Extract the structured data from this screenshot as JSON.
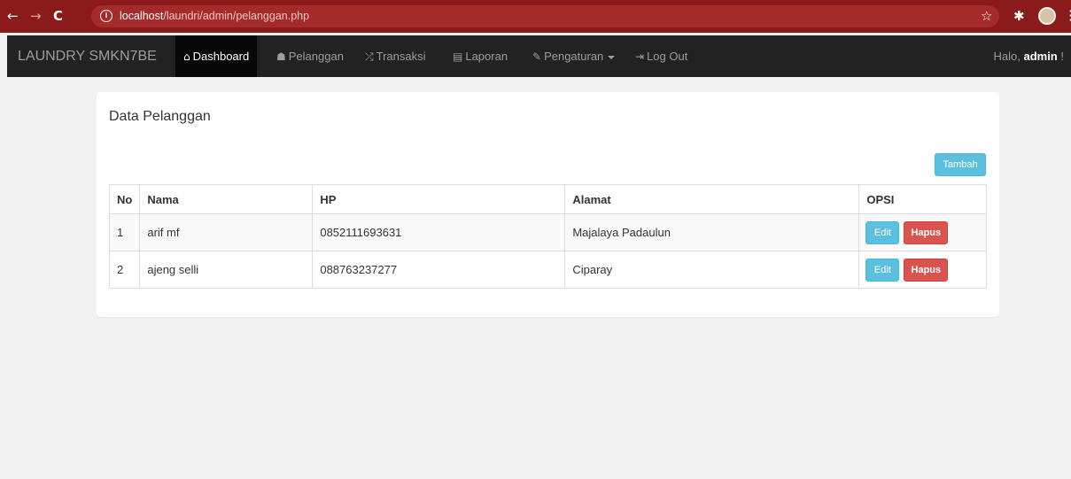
{
  "browser": {
    "back_icon": "arrow-left-icon",
    "forward_icon": "arrow-right-icon",
    "reload_icon": "reload-icon",
    "url_host": "localhost",
    "url_path": "/laundri/admin/pelanggan.php",
    "colors": {
      "bar": "#8b1a1a",
      "address": "#a52a2a"
    }
  },
  "navbar": {
    "brand": "LAUNDRY SMKN7BE",
    "items": [
      {
        "label": "Dashboard",
        "icon": "home-icon",
        "active": true
      },
      {
        "label": "Pelanggan",
        "icon": "user-icon",
        "active": false
      },
      {
        "label": "Transaksi",
        "icon": "shuffle-icon",
        "active": false
      },
      {
        "label": "Laporan",
        "icon": "list-alt-icon",
        "active": false
      },
      {
        "label": "Pengaturan",
        "icon": "wrench-icon",
        "active": false,
        "dropdown": true
      },
      {
        "label": "Log Out",
        "icon": "log-out-icon",
        "active": false
      }
    ],
    "greeting_prefix": "Halo, ",
    "greeting_user": "admin",
    "greeting_suffix": " !"
  },
  "panel": {
    "title": "Data Pelanggan",
    "add_button": "Tambah"
  },
  "table": {
    "headers": [
      "No",
      "Nama",
      "HP",
      "Alamat",
      "OPSI"
    ],
    "rows": [
      {
        "no": "1",
        "nama": "arif mf",
        "hp": "0852111693631",
        "alamat": "Majalaya Padaulun",
        "edit": "Edit",
        "hapus": "Hapus"
      },
      {
        "no": "2",
        "nama": "ajeng selli",
        "hp": "088763237277",
        "alamat": "Ciparay",
        "edit": "Edit",
        "hapus": "Hapus"
      }
    ]
  },
  "colors": {
    "info": "#5bc0de",
    "danger": "#d9534f",
    "navbar": "#222222"
  }
}
